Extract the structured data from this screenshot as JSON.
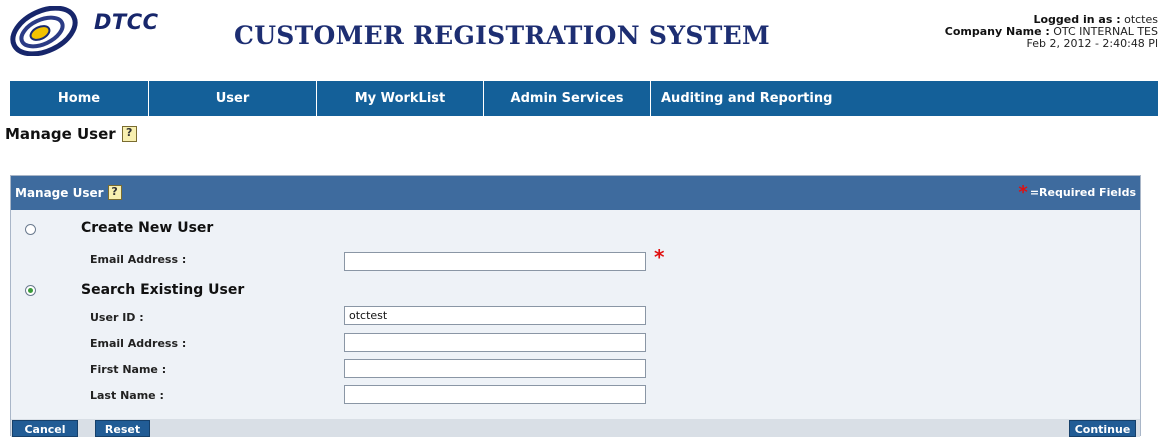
{
  "header": {
    "logo_text": "DTCC",
    "app_title": "CUSTOMER REGISTRATION SYSTEM",
    "logged_in_label": "Logged in as :",
    "logged_in_value": "otctes",
    "company_label": "Company Name :",
    "company_value": "OTC INTERNAL TES",
    "datetime": "Feb 2, 2012 - 2:40:48 Pl"
  },
  "nav": {
    "items": [
      {
        "label": "Home"
      },
      {
        "label": "User"
      },
      {
        "label": "My WorkList"
      },
      {
        "label": "Admin Services"
      },
      {
        "label": "Auditing and Reporting"
      }
    ]
  },
  "page": {
    "heading": "Manage User"
  },
  "panel": {
    "title": "Manage User",
    "required_legend": "=Required Fields",
    "required_mark": "*",
    "create_section": {
      "title": "Create New User",
      "selected": false,
      "email_label": "Email Address :",
      "email_value": ""
    },
    "search_section": {
      "title": "Search Existing User",
      "selected": true,
      "user_id_label": "User ID :",
      "user_id_value": "otctest",
      "email_label": "Email Address :",
      "email_value": "",
      "first_name_label": "First Name :",
      "first_name_value": "",
      "last_name_label": "Last Name :",
      "last_name_value": ""
    }
  },
  "buttons": {
    "cancel": "Cancel",
    "reset": "Reset",
    "continue": "Continue"
  },
  "colors": {
    "nav_bg": "#146099",
    "panel_header_bg": "#3e6b9e",
    "button_bg": "#215c95",
    "required_star": "#e01010",
    "title_text": "#1d2e72"
  }
}
